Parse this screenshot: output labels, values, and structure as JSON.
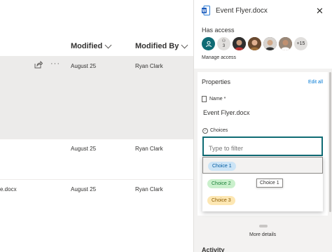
{
  "list": {
    "columns": {
      "modified": "Modified",
      "modified_by": "Modified By"
    },
    "rows": [
      {
        "name": "",
        "modified": "August 25",
        "modified_by": "Ryan Clark",
        "selected": true
      },
      {
        "name": "",
        "modified": "August 25",
        "modified_by": "Ryan Clark",
        "selected": false
      },
      {
        "name": "e.docx",
        "modified": "August 25",
        "modified_by": "Ryan Clark",
        "selected": false
      }
    ],
    "row_actions": {
      "share_icon": "share-icon",
      "more_label": "···"
    }
  },
  "panel": {
    "title": "Event Flyer.docx",
    "close_label": "✕",
    "has_access_label": "Has access",
    "avatars": [
      {
        "kind": "initial-icon",
        "label": "",
        "color": "#0f6b74"
      },
      {
        "kind": "group",
        "label": "3",
        "color": "#e1dfdd"
      },
      {
        "kind": "photo",
        "label": "",
        "color": "#5a3e2b"
      },
      {
        "kind": "photo",
        "label": "",
        "color": "#8a5a3a"
      },
      {
        "kind": "photo",
        "label": "",
        "color": "#3a3a3a"
      },
      {
        "kind": "photo",
        "label": "",
        "color": "#6b5544"
      },
      {
        "kind": "more",
        "label": "+15",
        "color": "#e1dfdd"
      }
    ],
    "manage_access_label": "Manage access",
    "properties": {
      "title": "Properties",
      "edit_all_label": "Edit all",
      "name_label": "Name *",
      "name_value": "Event Flyer.docx",
      "choices_label": "Choices",
      "filter_placeholder": "Type to filter",
      "options": [
        {
          "label": "Choice 1",
          "bg": "#cce4f6",
          "fg": "#005a9e"
        },
        {
          "label": "Choice 2",
          "bg": "#caf0cc",
          "fg": "#1a7f37"
        },
        {
          "label": "Choice 3",
          "bg": "#fde7b3",
          "fg": "#8a5a00"
        }
      ],
      "tooltip": "Choice 1"
    },
    "more_details_label": "More details",
    "activity_label": "Activity"
  },
  "colors": {
    "accent": "#0078d4",
    "focus_border": "#0f6b74",
    "selected_row": "#ecebea"
  }
}
